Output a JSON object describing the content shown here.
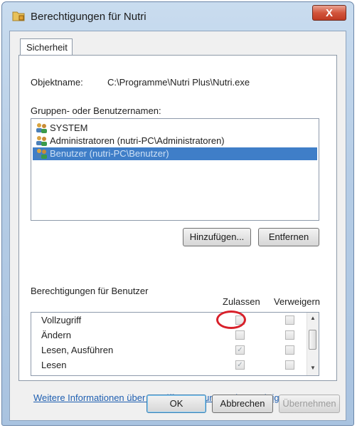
{
  "window": {
    "title": "Berechtigungen für Nutri",
    "close_glyph": "X",
    "title_icon": "folder-lock-icon"
  },
  "tabs": [
    {
      "label": "Sicherheit",
      "selected": true
    }
  ],
  "object": {
    "label": "Objektname:",
    "value": "C:\\Programme\\Nutri Plus\\Nutri.exe"
  },
  "groups": {
    "label": "Gruppen- oder Benutzernamen:",
    "items": [
      {
        "label": "SYSTEM",
        "icon": "users-icon",
        "selected": false
      },
      {
        "label": "Administratoren (nutri-PC\\Administratoren)",
        "icon": "users-icon",
        "selected": false
      },
      {
        "label": "Benutzer (nutri-PC\\Benutzer)",
        "icon": "users-icon",
        "selected": true
      }
    ]
  },
  "group_buttons": {
    "add": "Hinzufügen...",
    "remove": "Entfernen"
  },
  "permissions": {
    "label": "Berechtigungen für Benutzer",
    "col_allow": "Zulassen",
    "col_deny": "Verweigern",
    "rows": [
      {
        "name": "Vollzugriff",
        "allow": false,
        "deny": false
      },
      {
        "name": "Ändern",
        "allow": false,
        "deny": false
      },
      {
        "name": "Lesen, Ausführen",
        "allow": true,
        "deny": false
      },
      {
        "name": "Lesen",
        "allow": true,
        "deny": false
      }
    ]
  },
  "info_link": "Weitere Informationen über Zugriffssteuerung und Berechtigungen",
  "footer_buttons": {
    "ok": "OK",
    "cancel": "Abbrechen",
    "apply": "Übernehmen"
  },
  "colors": {
    "selection": "#3f7ec8",
    "highlight_circle": "#d8202a",
    "link": "#1f5fb1"
  }
}
